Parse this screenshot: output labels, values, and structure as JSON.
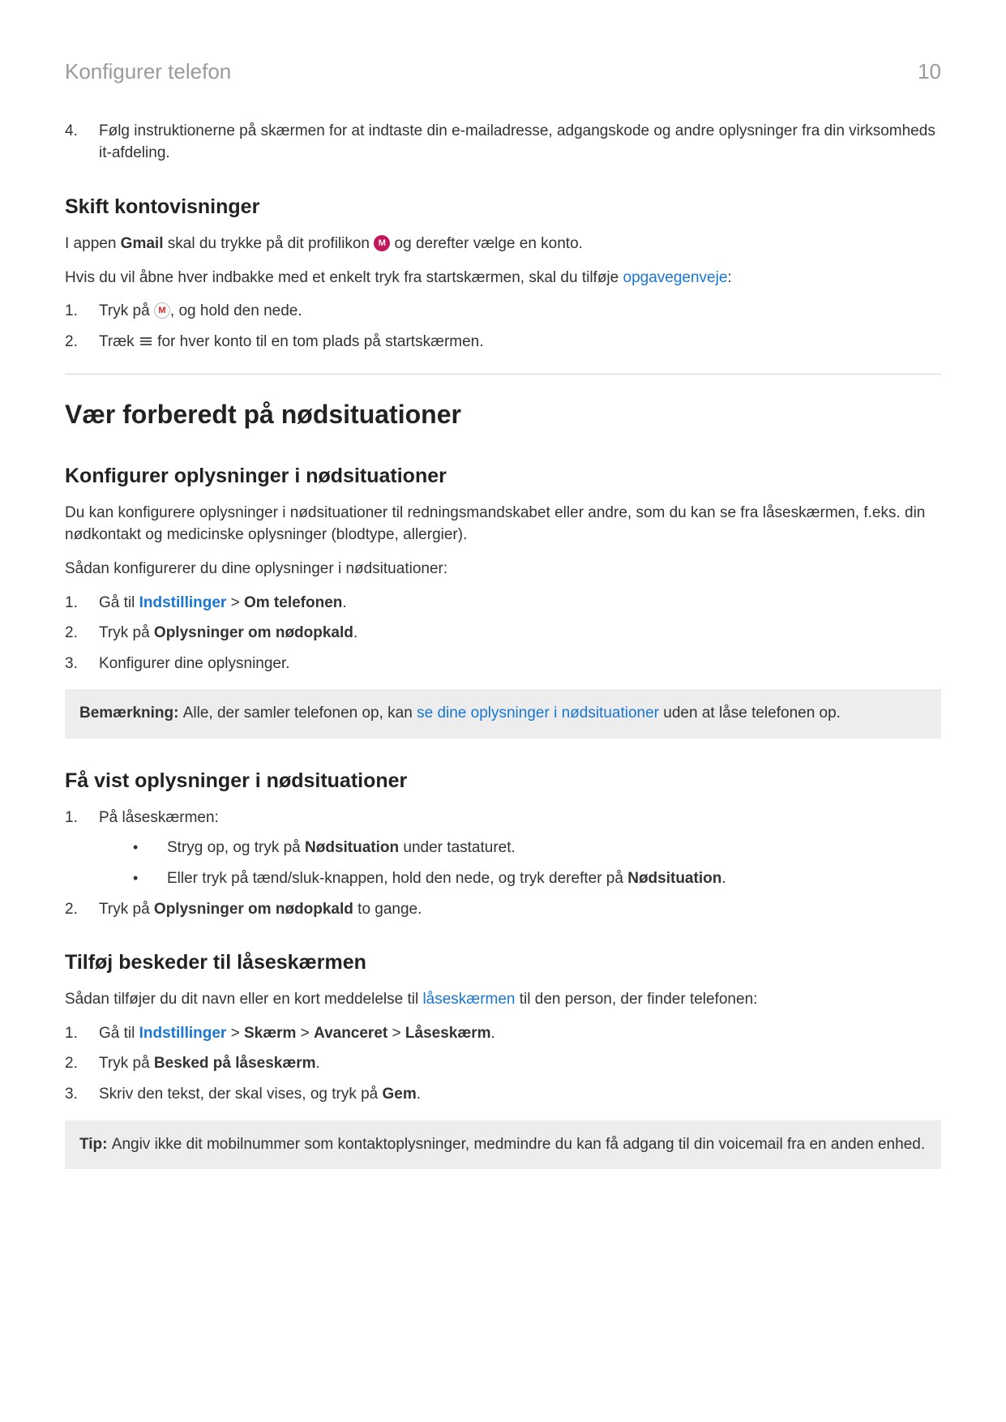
{
  "header": {
    "title": "Konfigurer telefon",
    "page": "10"
  },
  "step4": {
    "num": "4.",
    "text": "Følg instruktionerne på skærmen for at indtaste din e-mailadresse, adgangskode og andre oplysninger fra din virksomheds it-afdeling."
  },
  "sectionA": {
    "heading": "Skift kontovisninger",
    "para1a": "I appen ",
    "para1b": "Gmail",
    "para1c": " skal du trykke på dit profilikon ",
    "para1d": " og derefter vælge en konto.",
    "para2a": "Hvis du vil åbne hver indbakke med et enkelt tryk fra startskærmen, skal du tilføje ",
    "para2link": "opgavegenveje",
    "para2b": ":",
    "list": {
      "i1num": "1.",
      "i1a": "Tryk på ",
      "i1b": ", og hold den nede.",
      "i2num": "2.",
      "i2a": "Træk ",
      "i2b": " for hver konto til en tom plads på startskærmen."
    },
    "iconM": "M",
    "iconGmail": "M"
  },
  "mainHeading": "Vær forberedt på nødsituationer",
  "sectionB": {
    "heading": "Konfigurer oplysninger i nødsituationer",
    "para1": "Du kan konfigurere oplysninger i nødsituationer til redningsmandskabet eller andre, som du kan se fra låseskærmen, f.eks. din nødkontakt og medicinske oplysninger (blodtype, allergier).",
    "para2": "Sådan konfigurerer du dine oplysninger i nødsituationer:",
    "list": {
      "i1num": "1.",
      "i1a": "Gå til ",
      "i1link": "Indstillinger",
      "i1b": " > ",
      "i1bold": "Om telefonen",
      "i1c": ".",
      "i2num": "2.",
      "i2a": "Tryk på ",
      "i2bold": "Oplysninger om nødopkald",
      "i2b": ".",
      "i3num": "3.",
      "i3a": "Konfigurer dine oplysninger."
    },
    "note": {
      "label": "Bemærkning: ",
      "a": "Alle, der samler telefonen op, kan ",
      "link": "se dine oplysninger i nødsituationer",
      "b": " uden at låse telefonen op."
    }
  },
  "sectionC": {
    "heading": "Få vist oplysninger i nødsituationer",
    "i1num": "1.",
    "i1a": "På låseskærmen:",
    "sub1a": "Stryg op, og tryk på ",
    "sub1bold": "Nødsituation",
    "sub1b": " under tastaturet.",
    "sub2a": "Eller tryk på tænd/sluk-knappen, hold den nede, og tryk derefter på ",
    "sub2bold": "Nødsituation",
    "sub2b": ".",
    "i2num": "2.",
    "i2a": "Tryk på ",
    "i2bold": "Oplysninger om nødopkald",
    "i2b": " to gange."
  },
  "sectionD": {
    "heading": "Tilføj beskeder til låseskærmen",
    "para1a": "Sådan tilføjer du dit navn eller en kort meddelelse til ",
    "para1link": "låseskærmen",
    "para1b": " til den person, der finder telefonen:",
    "list": {
      "i1num": "1.",
      "i1a": "Gå til ",
      "i1link": "Indstillinger",
      "i1b": " > ",
      "i1bold1": "Skærm",
      "i1c": " > ",
      "i1bold2": "Avanceret",
      "i1d": " > ",
      "i1bold3": "Låseskærm",
      "i1e": ".",
      "i2num": "2.",
      "i2a": "Tryk på ",
      "i2bold": "Besked på låseskærm",
      "i2b": ".",
      "i3num": "3.",
      "i3a": "Skriv den tekst, der skal vises, og tryk på ",
      "i3bold": "Gem",
      "i3b": "."
    },
    "tip": {
      "label": "Tip: ",
      "text": "Angiv ikke dit mobilnummer som kontaktoplysninger, medmindre du kan få adgang til din voicemail fra en anden enhed."
    }
  }
}
